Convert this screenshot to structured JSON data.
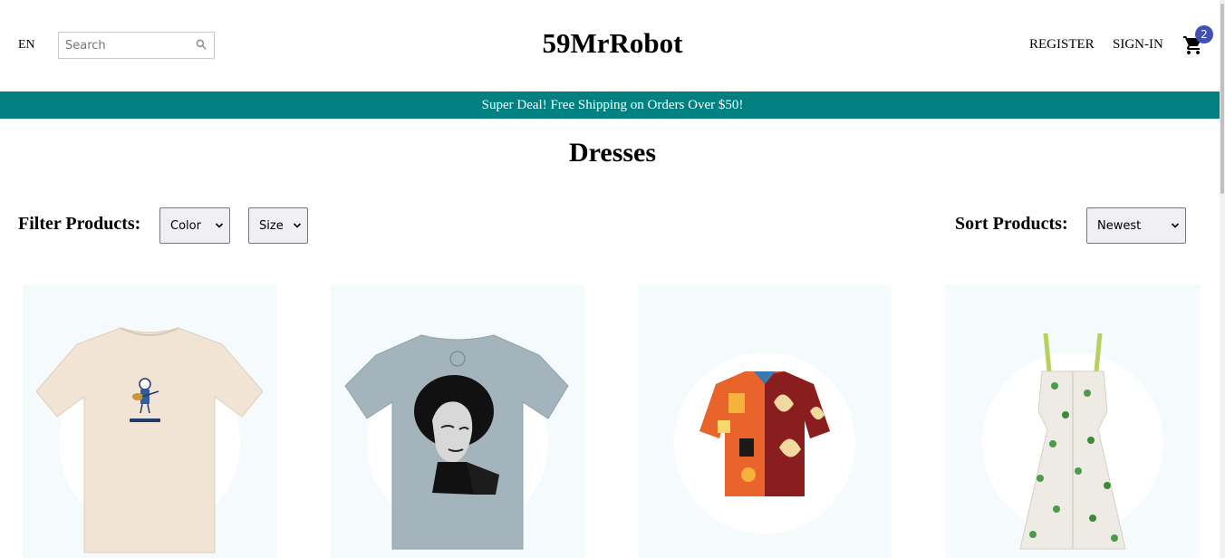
{
  "navbar": {
    "language": "EN",
    "search_placeholder": "Search",
    "logo": "59MrRobot",
    "register": "REGISTER",
    "signin": "SIGN-IN",
    "cart_count": "2",
    "cart_badge_color": "#3f51b5"
  },
  "announcement": {
    "text": "Super Deal! Free Shipping on Orders Over $50!",
    "background": "#008080"
  },
  "page": {
    "title": "Dresses"
  },
  "filters": {
    "filter_label": "Filter Products:",
    "color_selected": "Color",
    "size_selected": "Size",
    "sort_label": "Sort Products:",
    "sort_selected": "Newest"
  },
  "products": [
    {
      "icon": "cream-tshirt-image"
    },
    {
      "icon": "grey-portrait-tshirt-image"
    },
    {
      "icon": "patterned-shirt-image"
    },
    {
      "icon": "floral-dress-image"
    }
  ]
}
